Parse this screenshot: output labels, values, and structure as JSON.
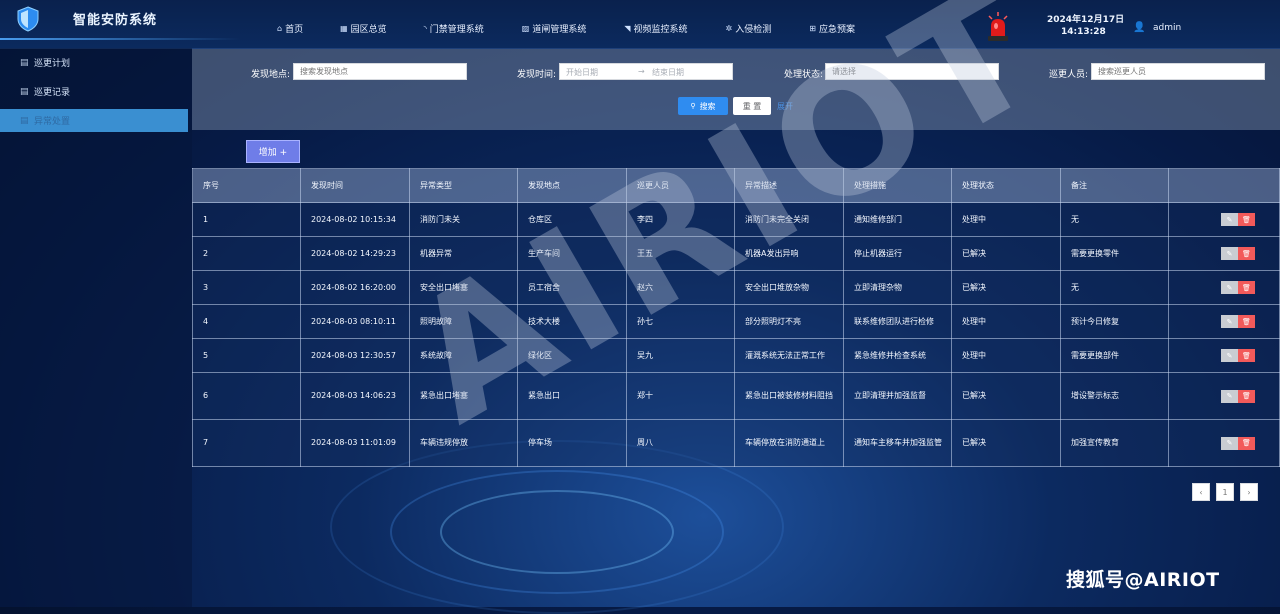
{
  "app": {
    "title": "智能安防系统"
  },
  "nav": [
    {
      "icon": "home-icon",
      "glyph": "⌂",
      "label": "首页"
    },
    {
      "icon": "park-overview-icon",
      "glyph": "▦",
      "label": "园区总览"
    },
    {
      "icon": "access-control-icon",
      "glyph": "◝",
      "label": "门禁管理系统"
    },
    {
      "icon": "road-gate-icon",
      "glyph": "▨",
      "label": "道闸管理系统"
    },
    {
      "icon": "video-surveillance-icon",
      "glyph": "◥",
      "label": "视频监控系统"
    },
    {
      "icon": "intrusion-detection-icon",
      "glyph": "✲",
      "label": "入侵检测"
    },
    {
      "icon": "emergency-plan-icon",
      "glyph": "⊞",
      "label": "应急预案"
    }
  ],
  "header": {
    "date": "2024年12月17日",
    "time": "14:13:28",
    "user": "admin"
  },
  "sidebar": {
    "items": [
      {
        "label": "巡更计划",
        "active": false
      },
      {
        "label": "巡更记录",
        "active": false
      },
      {
        "label": "异常处置",
        "active": true
      }
    ]
  },
  "filter": {
    "location_label": "发现地点:",
    "location_placeholder": "搜索发现地点",
    "time_label": "发现时间:",
    "start_placeholder": "开始日期",
    "range_sep": "→",
    "end_placeholder": "结束日期",
    "status_label": "处理状态:",
    "status_placeholder": "请选择",
    "patroller_label": "巡更人员:",
    "patroller_placeholder": "搜索巡更人员",
    "search_label": "搜索",
    "reset_label": "重 置",
    "expand_label": "展开"
  },
  "add_label": "增加 +",
  "table": {
    "columns": [
      "序号",
      "发现时间",
      "异常类型",
      "发现地点",
      "巡更人员",
      "异常描述",
      "处理措施",
      "处理状态",
      "备注",
      ""
    ],
    "rows": [
      [
        "1",
        "2024-08-02 10:15:34",
        "消防门未关",
        "仓库区",
        "李四",
        "消防门未完全关闭",
        "通知维修部门",
        "处理中",
        "无"
      ],
      [
        "2",
        "2024-08-02 14:29:23",
        "机器异常",
        "生产车间",
        "王五",
        "机器A发出异响",
        "停止机器运行",
        "已解决",
        "需要更换零件"
      ],
      [
        "3",
        "2024-08-02 16:20:00",
        "安全出口堵塞",
        "员工宿舍",
        "赵六",
        "安全出口堆放杂物",
        "立即清理杂物",
        "已解决",
        "无"
      ],
      [
        "4",
        "2024-08-03 08:10:11",
        "照明故障",
        "技术大楼",
        "孙七",
        "部分照明灯不亮",
        "联系维修团队进行检修",
        "处理中",
        "预计今日修复"
      ],
      [
        "5",
        "2024-08-03 12:30:57",
        "系统故障",
        "绿化区",
        "吴九",
        "灌溉系统无法正常工作",
        "紧急维修并检查系统",
        "处理中",
        "需要更换部件"
      ],
      [
        "6",
        "2024-08-03 14:06:23",
        "紧急出口堵塞",
        "紧急出口",
        "郑十",
        "紧急出口被装修材料阻挡",
        "立即清理并加强监督",
        "已解决",
        "增设警示标志"
      ],
      [
        "7",
        "2024-08-03 11:01:09",
        "车辆违规停放",
        "停车场",
        "周八",
        "车辆停放在消防通道上",
        "通知车主移车并加强监管",
        "已解决",
        "加强宣传教育"
      ]
    ]
  },
  "pagination": {
    "prev": "‹",
    "page": "1",
    "next": "›"
  },
  "watermark": "AIRIOT",
  "footer_watermark": "搜狐号@AIRIOT"
}
